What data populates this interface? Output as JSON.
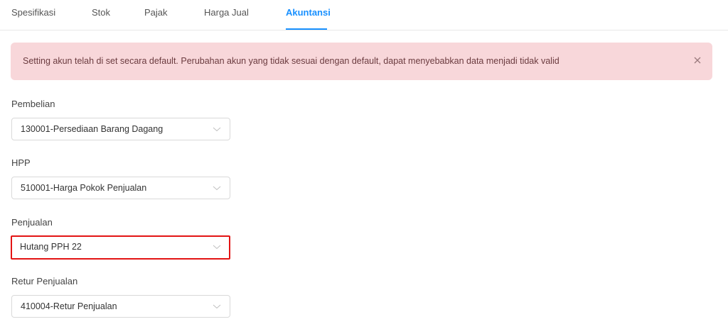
{
  "tabs": [
    {
      "label": "Spesifikasi"
    },
    {
      "label": "Stok"
    },
    {
      "label": "Pajak"
    },
    {
      "label": "Harga Jual"
    },
    {
      "label": "Akuntansi"
    }
  ],
  "active_tab": "Akuntansi",
  "alert": {
    "message": "Setting akun telah di set secara default. Perubahan akun yang tidak sesuai dengan default, dapat menyebabkan data menjadi tidak valid",
    "close_icon": "close-icon"
  },
  "fields": {
    "pembelian": {
      "label": "Pembelian",
      "value": "130001-Persediaan Barang Dagang"
    },
    "hpp": {
      "label": "HPP",
      "value": "510001-Harga Pokok Penjualan"
    },
    "penjualan": {
      "label": "Penjualan",
      "value": "Hutang PPH 22"
    },
    "retur_penjualan": {
      "label": "Retur Penjualan",
      "value": "410004-Retur Penjualan"
    }
  },
  "colors": {
    "accent": "#1890ff",
    "alert_bg": "#f8d7da",
    "highlight_border": "#e31414"
  }
}
